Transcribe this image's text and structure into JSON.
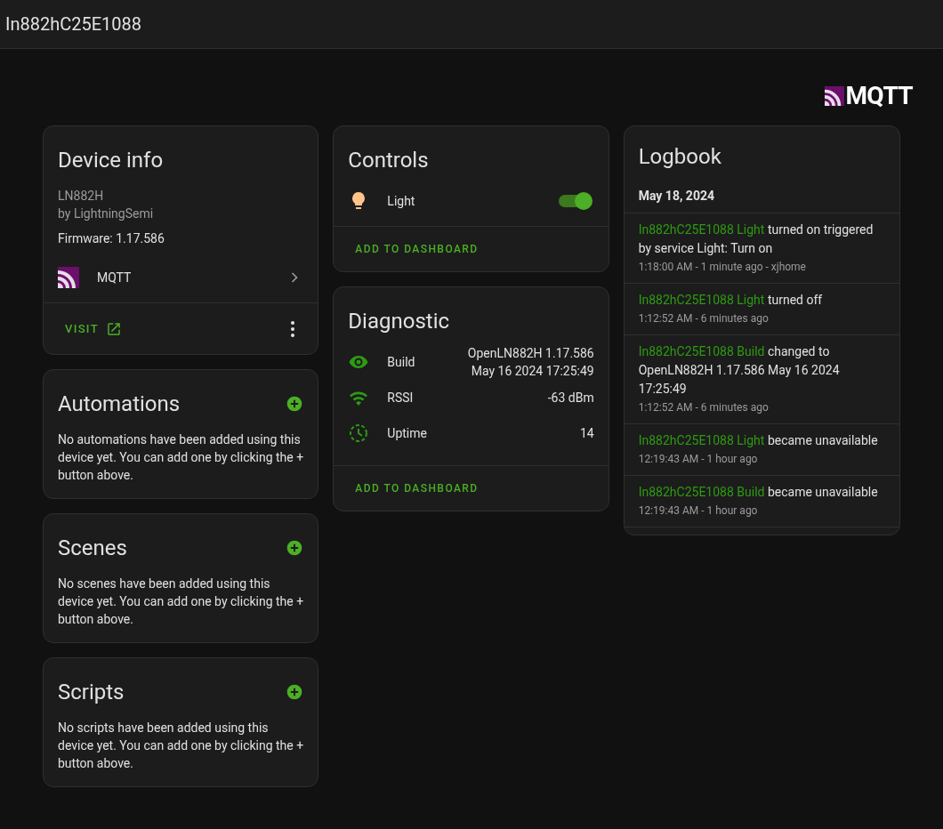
{
  "header": {
    "title": "In882hC25E1088"
  },
  "brand": {
    "text": "MQTT"
  },
  "device_info": {
    "title": "Device info",
    "model": "LN882H",
    "manufacturer": "by LightningSemi",
    "firmware": "Firmware: 1.17.586",
    "integration": "MQTT",
    "visit": "VISIT"
  },
  "automations": {
    "title": "Automations",
    "text": "No automations have been added using this device yet. You can add one by clicking the + button above."
  },
  "scenes": {
    "title": "Scenes",
    "text": "No scenes have been added using this device yet. You can add one by clicking the + button above."
  },
  "scripts": {
    "title": "Scripts",
    "text": "No scripts have been added using this device yet. You can add one by clicking the + button above."
  },
  "controls": {
    "title": "Controls",
    "entities": [
      {
        "name": "Light",
        "on": true
      }
    ],
    "action": "ADD TO DASHBOARD"
  },
  "diagnostic": {
    "title": "Diagnostic",
    "entities": [
      {
        "kind": "eye",
        "name": "Build",
        "value_lines": [
          "OpenLN882H 1.17.586",
          "May 16 2024 17:25:49"
        ]
      },
      {
        "kind": "wifi",
        "name": "RSSI",
        "value_lines": [
          "-63 dBm"
        ]
      },
      {
        "kind": "clock",
        "name": "Uptime",
        "value_lines": [
          "14"
        ]
      }
    ],
    "action": "ADD TO DASHBOARD"
  },
  "logbook": {
    "title": "Logbook",
    "date": "May 18, 2024",
    "entries": [
      {
        "entity": "In882hC25E1088 Light",
        "message": "turned on triggered by service Light: Turn on",
        "time": "1:18:00 AM - 1 minute ago - xjhome"
      },
      {
        "entity": "In882hC25E1088 Light",
        "message": "turned off",
        "time": "1:12:52 AM - 6 minutes ago"
      },
      {
        "entity": "In882hC25E1088 Build",
        "message": "changed to OpenLN882H 1.17.586 May 16 2024 17:25:49",
        "time": "1:12:52 AM - 6 minutes ago"
      },
      {
        "entity": "In882hC25E1088 Light",
        "message": "became unavailable",
        "time": "12:19:43 AM - 1 hour ago"
      },
      {
        "entity": "In882hC25E1088 Build",
        "message": "became unavailable",
        "time": "12:19:43 AM - 1 hour ago"
      }
    ]
  }
}
